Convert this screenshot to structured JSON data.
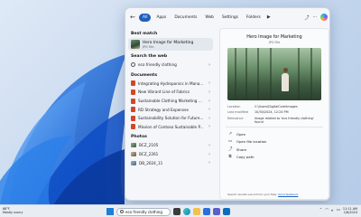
{
  "filters": {
    "back_icon": "back-arrow-icon",
    "chips": [
      "All",
      "Apps",
      "Documents",
      "Web",
      "Settings",
      "Folders"
    ],
    "play_icon": "play-icon",
    "share_icon": "share-icon",
    "more_icon": "more-icon",
    "copilot_icon": "copilot-icon"
  },
  "best_match": {
    "heading": "Best match",
    "title": "Hero Image for Marketing",
    "type": "JPG File"
  },
  "web": {
    "heading": "Search the web",
    "query": "eco friendly clothing"
  },
  "documents": {
    "heading": "Documents",
    "items": [
      "Integrating Hydroponics in Mana...",
      "New Vibrant Line of Fabrics",
      "Sustainable Clothing Marketing ...",
      "RD Strategy and Expenses",
      "Sustainability Solution for Future...",
      "Mission of Contoso Sustainable P..."
    ]
  },
  "photos": {
    "heading": "Photos",
    "items": [
      "BCZ_2105",
      "BCZ_2261",
      "DB_2024_11"
    ]
  },
  "preview": {
    "title": "Hero Image for Marketing",
    "type": "JPG File",
    "meta": [
      {
        "k": "Location",
        "v": "C:\\Users\\DigitalCore\\Images"
      },
      {
        "k": "Last modified",
        "v": "10/30/2024, 12:24 PM"
      },
      {
        "k": "Relevance",
        "v": "Image related to 'eco friendly clothing' found"
      }
    ],
    "actions": [
      {
        "label": "Open",
        "icon": "open-icon"
      },
      {
        "label": "Open file location",
        "icon": "folder-icon"
      },
      {
        "label": "Share",
        "icon": "share-icon"
      },
      {
        "label": "Copy path",
        "icon": "copy-icon"
      }
    ],
    "footer": "Search results use AI from your files.",
    "footer_link": "Send feedback"
  },
  "taskbar": {
    "temp": "68°F",
    "weather": "Mostly sunny",
    "search_value": "eco friendly clothing",
    "time": "11:11 AM",
    "date": "1/8/2024"
  },
  "colors": {
    "accent": "#1f5fbf",
    "ppt": "#d24726"
  }
}
